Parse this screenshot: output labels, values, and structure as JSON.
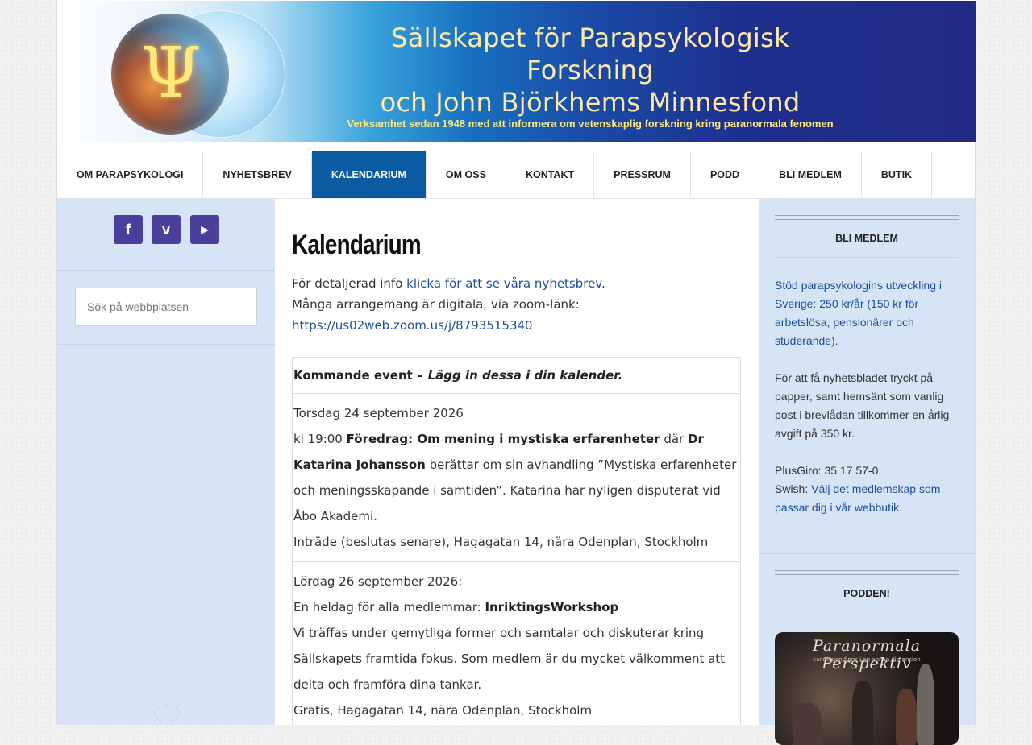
{
  "header": {
    "title_line1": "Sällskapet för Parapsykologisk Forskning",
    "title_line2": "och John Björkhems Minnesfond",
    "subtitle": "Verksamhet sedan 1948 med att informera om vetenskaplig forskning kring paranormala fenomen",
    "logo_glyph": "Ψ"
  },
  "nav": {
    "items": [
      "OM PARAPSYKOLOGI",
      "NYHETSBREV",
      "KALENDARIUM",
      "OM OSS",
      "KONTAKT",
      "PRESSRUM",
      "PODD",
      "BLI MEDLEM",
      "BUTIK"
    ],
    "active": "KALENDARIUM"
  },
  "left": {
    "social": [
      {
        "icon": "facebook-icon",
        "glyph": "f"
      },
      {
        "icon": "vimeo-icon",
        "glyph": "v"
      },
      {
        "icon": "youtube-icon",
        "glyph": "▶"
      }
    ],
    "search_placeholder": "Sök på webbplatsen"
  },
  "main": {
    "title": "Kalendarium",
    "intro_prefix": "För detaljerad info ",
    "intro_link": "klicka för att se våra nyhetsbrev",
    "intro_suffix": ".",
    "intro_line2": "Många arrangemang är digitala, via zoom-länk:",
    "zoom_link": "https://us02web.zoom.us/j/8793515340",
    "table_head_bold": "Kommande event –",
    "table_head_italic": "Lägg in dessa i din kalender.",
    "events": [
      {
        "date": "Torsdag 24 september 2026",
        "time": "kl 19:00",
        "title": "Föredrag: Om mening i mystiska erfarenheter",
        "connector": "där",
        "speaker": "Dr Katarina Johansson",
        "desc": "berättar om sin avhandling ”Mystiska erfarenheter och meningsskapande i samtiden”. Katarina har nyligen disputerat vid Åbo Akademi.",
        "place": "Inträde (beslutas senare), Hagagatan 14, nära Odenplan, Stockholm"
      },
      {
        "date": "Lördag 26 september 2026:",
        "lead": "En heldag för alla medlemmar:",
        "title": "InriktingsWorkshop",
        "desc": "Vi träffas under gemytliga former och samtalar och diskuterar kring Sällskapets framtida fokus. Som medlem är du mycket välkomment att delta och framföra dina tankar.",
        "place": "Gratis, Hagagatan 14, nära Odenplan, Stockholm"
      }
    ]
  },
  "right": {
    "widget1_title": "BLI MEDLEM",
    "widget1_link": "Stöd parapsykologins utveckling i Sverige: 250 kr/år (150 kr för arbetslösa, pensionärer och studerande).",
    "widget1_text": "För att få nyhetsbladet tryckt på papper, samt hemsänt som vanlig post i brevlådan tillkommer en årlig avgift på 350 kr.",
    "plusgiro": "PlusGiro: 35 17 57-0",
    "swish_label": "Swish: ",
    "swish_link": "Välj det medlemskap som passar dig i vår webbutik.",
    "widget2_title": "PODDEN!",
    "podd_title": "Paranormala Perspektiv",
    "podd_sub": "sanningen finns i en annan dimension"
  },
  "colors": {
    "nav_active_bg": "#0b5aa2",
    "sidebar_bg": "#d6e4f5",
    "link": "#1b4e9b",
    "social_bg": "#4a3f9a"
  }
}
